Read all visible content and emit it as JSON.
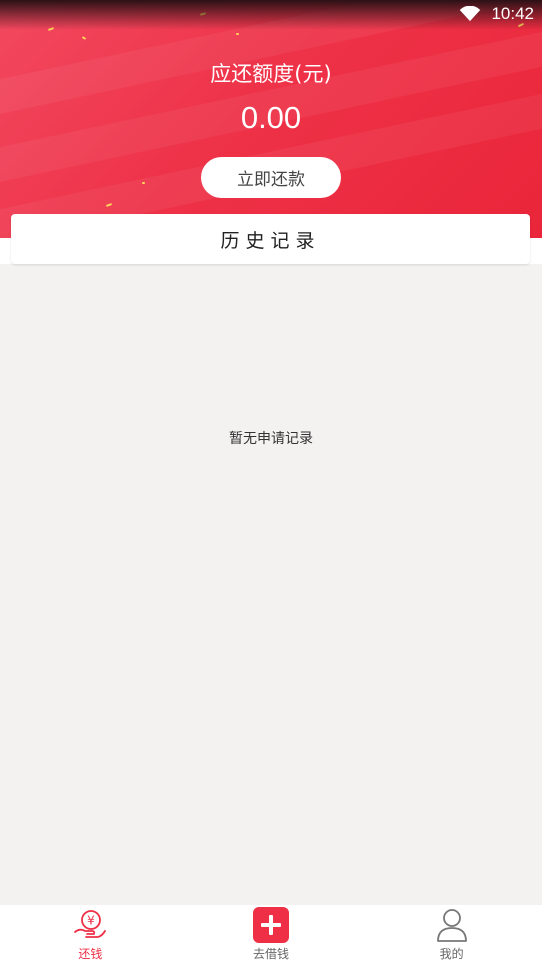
{
  "status": {
    "time": "10:42"
  },
  "header": {
    "title": "应还额度(元)",
    "amount": "0.00",
    "repay_button": "立即还款"
  },
  "history": {
    "title": "历史记录",
    "empty_text": "暂无申请记录"
  },
  "nav": {
    "items": [
      {
        "label": "还钱",
        "icon": "repay-hand-icon",
        "active": true
      },
      {
        "label": "去借钱",
        "icon": "plus-icon",
        "active": false
      },
      {
        "label": "我的",
        "icon": "user-icon",
        "active": false
      }
    ]
  },
  "colors": {
    "accent": "#ee2f45",
    "background": "#f4f1f1"
  }
}
